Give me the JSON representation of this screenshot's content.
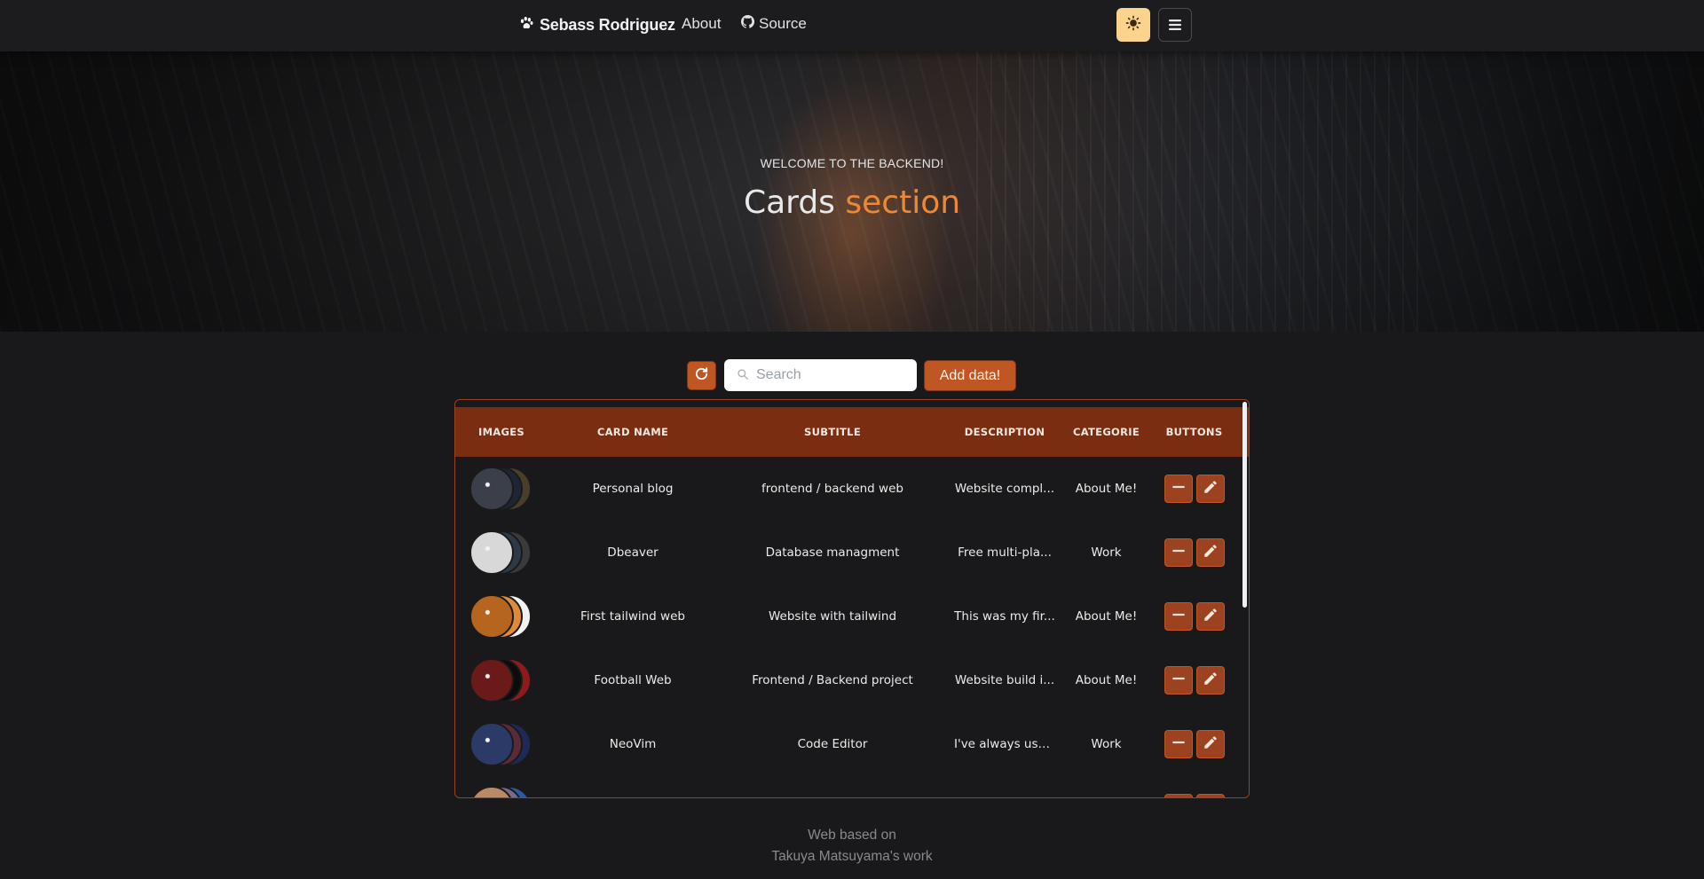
{
  "nav": {
    "brand": "Sebass Rodriguez",
    "links": [
      {
        "label": "About"
      },
      {
        "label": "Source",
        "icon": "github-icon"
      }
    ],
    "theme_toggle_icon": "sun-icon",
    "menu_icon": "hamburger-icon",
    "accent_color": "#fbd38d"
  },
  "hero": {
    "kicker": "WELCOME TO THE BACKEND!",
    "title_main": "Cards",
    "title_accent": "section",
    "accent_color": "#ed8936"
  },
  "toolbar": {
    "refresh_icon": "refresh-icon",
    "search_placeholder": "Search",
    "search_value": "",
    "add_label": "Add data!",
    "button_color": "#c05621"
  },
  "table": {
    "headers": [
      "IMAGES",
      "CARD NAME",
      "SUBTITLE",
      "DESCRIPTION",
      "CATEGORIE",
      "BUTTONS"
    ],
    "header_color": "#7b2d12",
    "rows": [
      {
        "name": "Personal blog",
        "subtitle": "frontend / backend web",
        "description": "Website compl...",
        "category": "About Me!",
        "thumbs": [
          "#3a3f4a",
          "#1e2533",
          "#4a3d2a"
        ]
      },
      {
        "name": "Dbeaver",
        "subtitle": "Database managment",
        "description": "Free multi-pla...",
        "category": "Work",
        "thumbs": [
          "#d8d8d8",
          "#2e3848",
          "#3a3a3a"
        ]
      },
      {
        "name": "First tailwind web",
        "subtitle": "Website with tailwind",
        "description": "This was my fir...",
        "category": "About Me!",
        "thumbs": [
          "#b5651d",
          "#e08a3a",
          "#f2f2f2"
        ]
      },
      {
        "name": "Football Web",
        "subtitle": "Frontend / Backend project",
        "description": "Website build i...",
        "category": "About Me!",
        "thumbs": [
          "#6b1a1a",
          "#0c0c0c",
          "#8e1b1b"
        ]
      },
      {
        "name": "NeoVim",
        "subtitle": "Code Editor",
        "description": "I've always use...",
        "category": "Work",
        "thumbs": [
          "#2b3a66",
          "#5a2a3a",
          "#1e2a55"
        ]
      }
    ],
    "partial_row_thumbs": [
      "#b88a6a",
      "#7a6a8a",
      "#2b5aa0"
    ],
    "remove_icon": "minus-icon",
    "edit_icon": "pencil-icon"
  },
  "footer": {
    "line1": "Web based on",
    "line2": "Takuya Matsuyama's work"
  }
}
